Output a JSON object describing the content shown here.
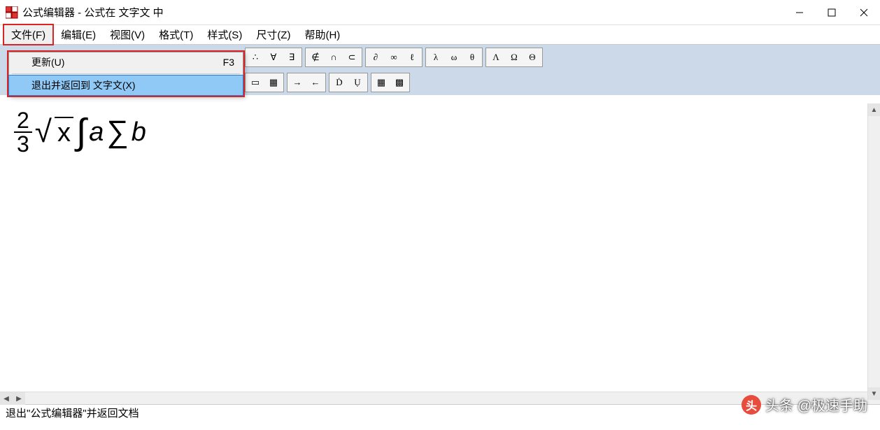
{
  "window": {
    "title": "公式编辑器 - 公式在 文字文 中"
  },
  "menubar": {
    "items": [
      "文件(F)",
      "编辑(E)",
      "视图(V)",
      "格式(T)",
      "样式(S)",
      "尺寸(Z)",
      "帮助(H)"
    ]
  },
  "dropdown": {
    "items": [
      {
        "label": "更新(U)",
        "shortcut": "F3",
        "selected": false
      },
      {
        "label": "退出并返回到 文字文(X)",
        "shortcut": "",
        "selected": true
      }
    ]
  },
  "toolbar": {
    "row1": [
      [
        "∴",
        "∀",
        "∃"
      ],
      [
        "∉",
        "∩",
        "⊂"
      ],
      [
        "∂",
        "∞",
        "ℓ"
      ],
      [
        "λ",
        "ω",
        "θ"
      ],
      [
        "Λ",
        "Ω",
        "Θ"
      ]
    ],
    "row2": [
      [
        "▭",
        "▦"
      ],
      [
        "→",
        "←"
      ],
      [
        "Ḋ",
        "Ụ"
      ],
      [
        "▦",
        "▩"
      ]
    ]
  },
  "formula": {
    "frac_num": "2",
    "frac_den": "3",
    "sqrt_body": "x",
    "int_body": "a",
    "sum_body": "b"
  },
  "statusbar": {
    "text": "退出\"公式编辑器\"并返回文档"
  },
  "watermark": {
    "badge": "头",
    "text": "头条 @极速手助"
  }
}
